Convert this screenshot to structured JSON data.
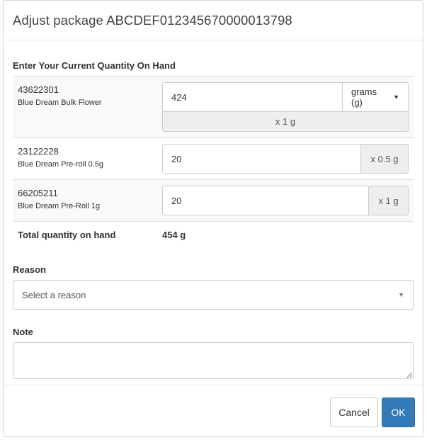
{
  "dialog": {
    "title": "Adjust package ABCDEF012345670000013798"
  },
  "section_title": "Enter Your Current Quantity On Hand",
  "items": [
    {
      "sku": "43622301",
      "name": "Blue Dream Bulk Flower",
      "quantity": "424",
      "unit_select": "grams (g)",
      "conversion": "x 1 g"
    },
    {
      "sku": "23122228",
      "name": "Blue Dream Pre-roll 0.5g",
      "quantity": "20",
      "conversion": "x 0.5 g"
    },
    {
      "sku": "66205211",
      "name": "Blue Dream Pre-Roll 1g",
      "quantity": "20",
      "conversion": "x 1 g"
    }
  ],
  "total": {
    "label": "Total quantity on hand",
    "value": "454 g"
  },
  "reason": {
    "label": "Reason",
    "placeholder": "Select a reason"
  },
  "note": {
    "label": "Note",
    "value": ""
  },
  "footer": {
    "cancel_label": "Cancel",
    "ok_label": "OK"
  },
  "colors": {
    "primary": "#337ab7",
    "addon_bg": "#eeeeee",
    "border": "#cccccc"
  }
}
